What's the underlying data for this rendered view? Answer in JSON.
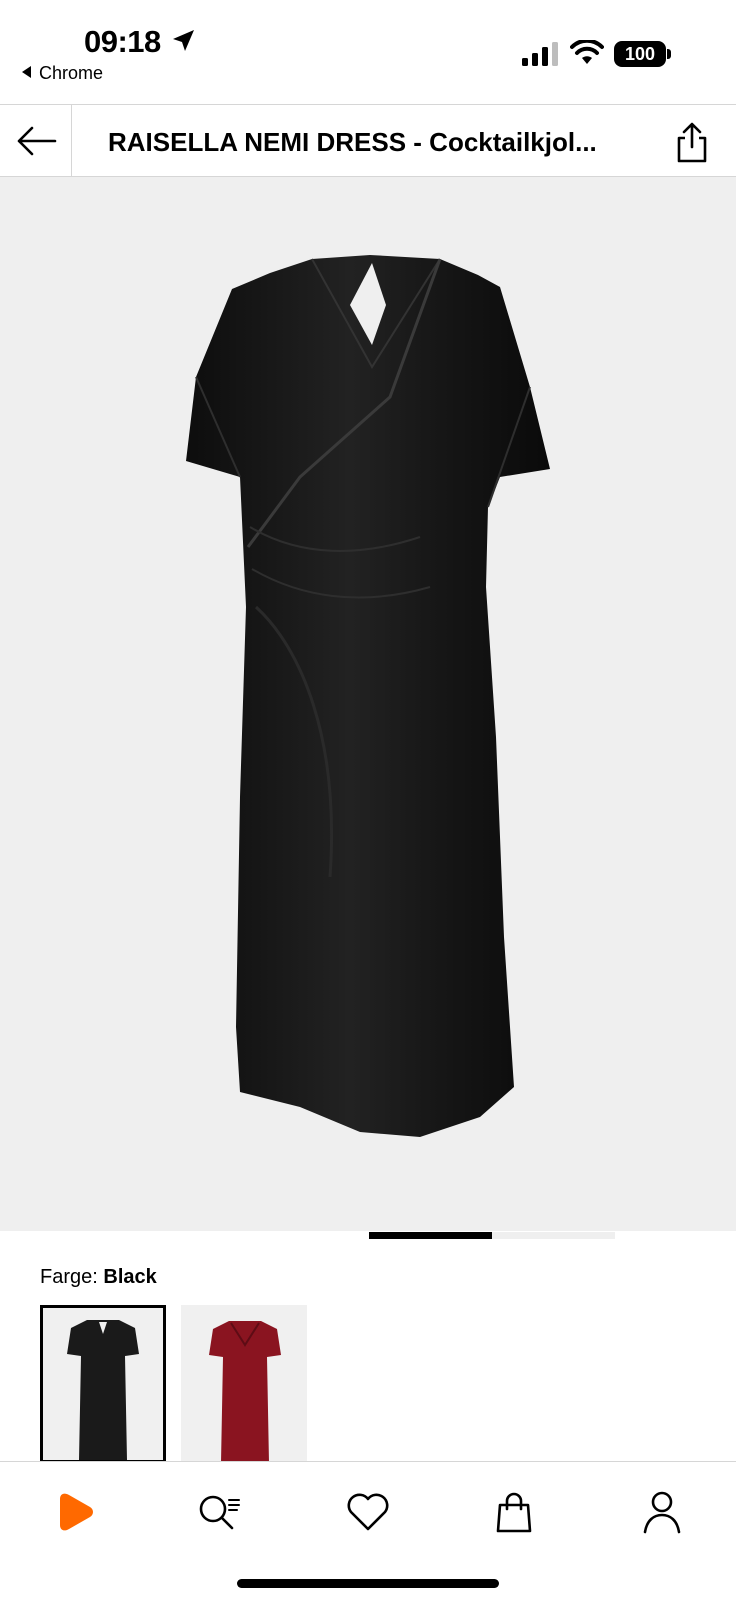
{
  "status_bar": {
    "time": "09:18",
    "back_app": "Chrome",
    "battery": "100"
  },
  "header": {
    "title": "RAISELLA NEMI DRESS - Cocktailkjol..."
  },
  "product": {
    "color_label": "Farge:",
    "color_value": "Black",
    "swatches": [
      {
        "color": "Black",
        "fill": "#1a1a1a",
        "selected": true
      },
      {
        "color": "Red",
        "fill": "#8a1420",
        "selected": false
      }
    ]
  },
  "carousel": {
    "current_slide": 1,
    "total_slides": 2
  },
  "icons": {
    "back": "arrow-left-icon",
    "share": "share-icon",
    "favorite": "heart-icon",
    "bag": "shopping-bag-icon",
    "nav": [
      "home-logo-icon",
      "search-icon",
      "heart-icon",
      "bag-icon",
      "profile-icon"
    ]
  },
  "colors": {
    "brand_orange": "#ff6900",
    "image_bg": "#efefef"
  }
}
